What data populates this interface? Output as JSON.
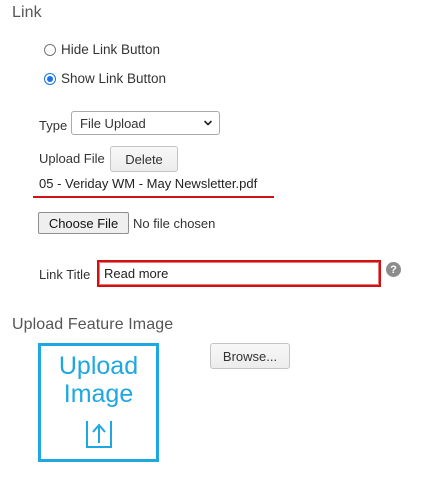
{
  "link_section": {
    "heading": "Link",
    "radio_hide": "Hide Link Button",
    "radio_show": "Show Link Button",
    "selected_radio": "show",
    "type_label": "Type",
    "type_value": "File Upload",
    "upload_file_label": "Upload File",
    "delete_label": "Delete",
    "filename": "05 - Veriday WM - May Newsletter.pdf",
    "choose_file_label": "Choose File",
    "no_file_text": "No file chosen",
    "link_title_label": "Link Title",
    "link_title_value": "Read more",
    "help_glyph": "?"
  },
  "feature_image_section": {
    "heading": "Upload Feature Image",
    "placeholder_line1": "Upload",
    "placeholder_line2": "Image",
    "browse_label": "Browse..."
  },
  "colors": {
    "accent_blue": "#1ea7e1",
    "highlight_red": "#d01111",
    "radio_blue": "#1a73e8"
  },
  "icons": {
    "upload": "upload-arrow-icon",
    "select": "chevron-down-icon",
    "help": "help-icon"
  }
}
